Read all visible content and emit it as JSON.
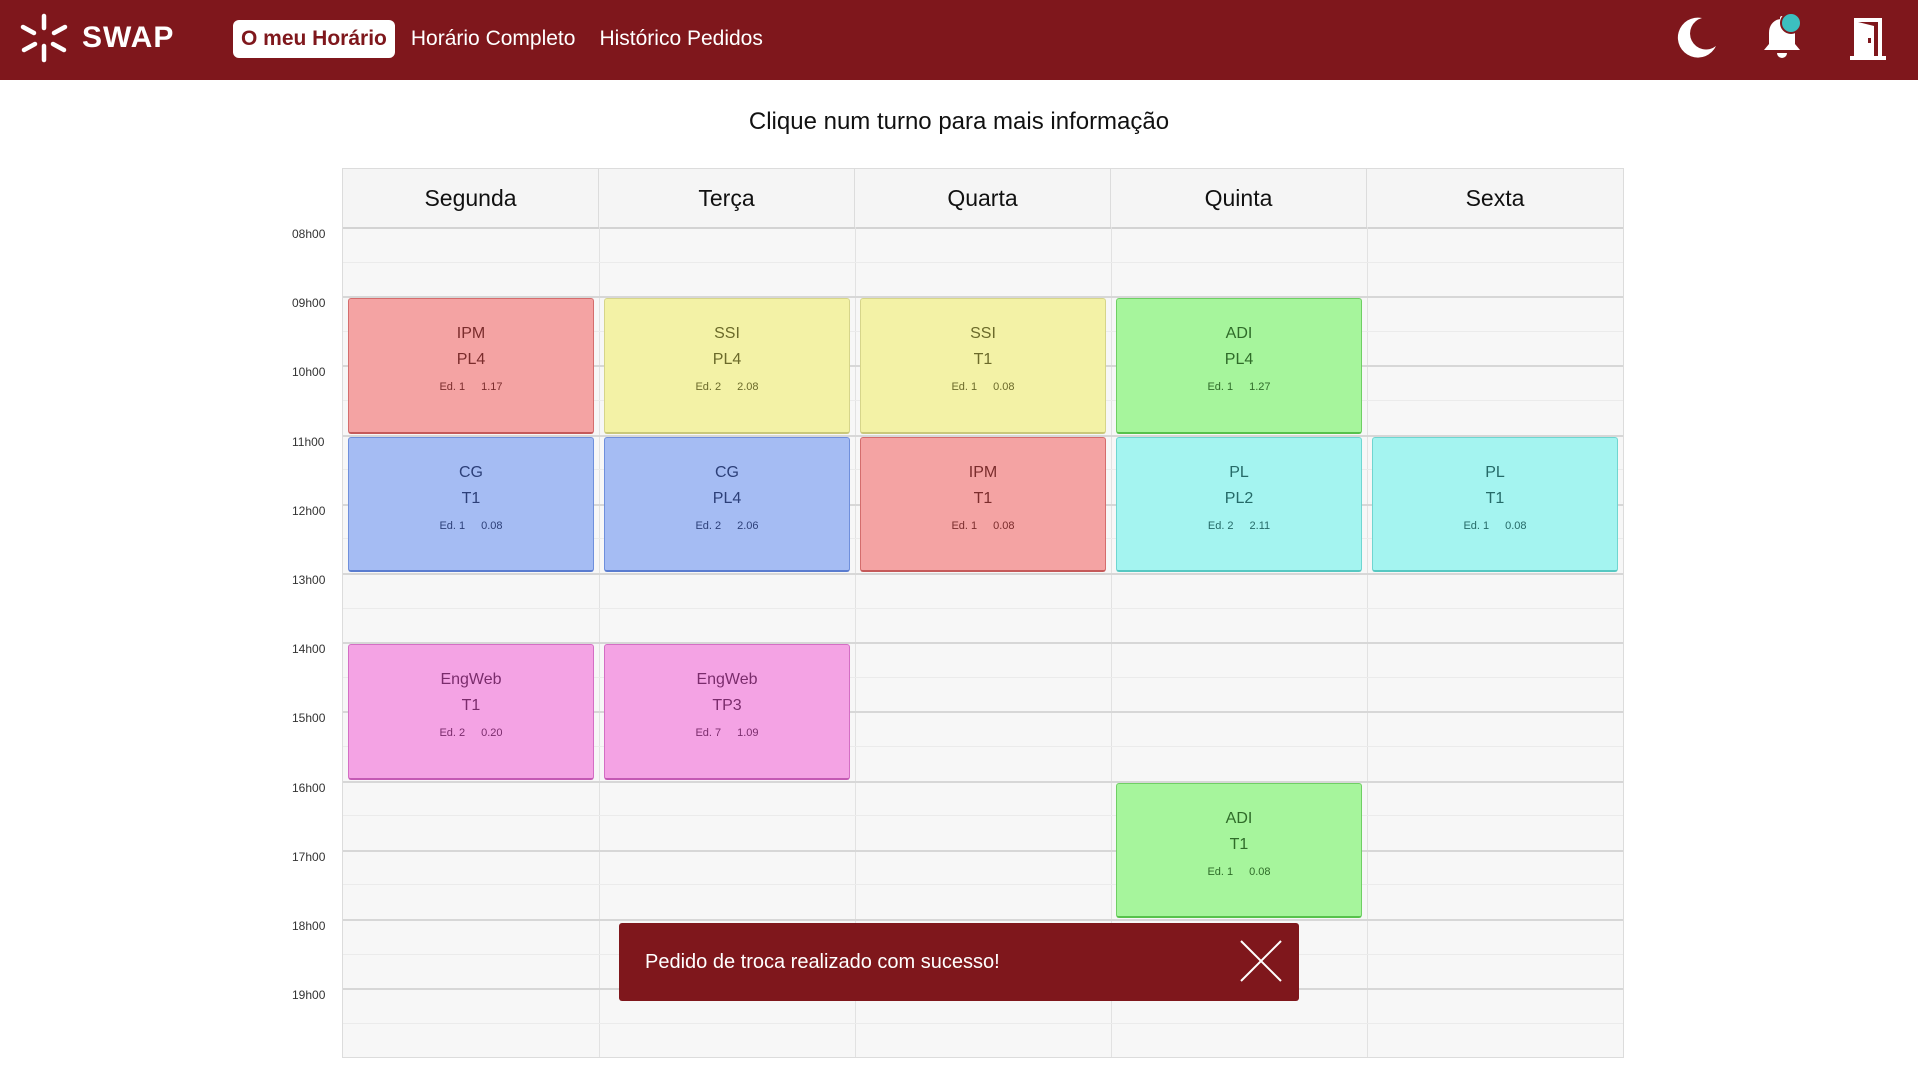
{
  "app": {
    "name": "SWAP"
  },
  "nav": {
    "items": [
      {
        "label": "O meu Horário",
        "active": true
      },
      {
        "label": "Horário Completo",
        "active": false
      },
      {
        "label": "Histórico Pedidos",
        "active": false
      }
    ]
  },
  "header_icons": [
    "moon-icon",
    "bell-icon",
    "logout-door-icon"
  ],
  "page": {
    "title": "Clique num turno para mais informação"
  },
  "days": [
    "Segunda",
    "Terça",
    "Quarta",
    "Quinta",
    "Sexta"
  ],
  "hours": [
    "08h00",
    "09h00",
    "10h00",
    "11h00",
    "12h00",
    "13h00",
    "14h00",
    "15h00",
    "16h00",
    "17h00",
    "18h00",
    "19h00"
  ],
  "shifts": [
    {
      "day": 0,
      "start": 9,
      "end": 11,
      "subject": "IPM",
      "type": "PL4",
      "building": "Ed. 1",
      "room": "1.17",
      "color": "red"
    },
    {
      "day": 1,
      "start": 9,
      "end": 11,
      "subject": "SSI",
      "type": "PL4",
      "building": "Ed. 2",
      "room": "2.08",
      "color": "yellow"
    },
    {
      "day": 2,
      "start": 9,
      "end": 11,
      "subject": "SSI",
      "type": "T1",
      "building": "Ed. 1",
      "room": "0.08",
      "color": "yellow"
    },
    {
      "day": 3,
      "start": 9,
      "end": 11,
      "subject": "ADI",
      "type": "PL4",
      "building": "Ed. 1",
      "room": "1.27",
      "color": "green"
    },
    {
      "day": 0,
      "start": 11,
      "end": 13,
      "subject": "CG",
      "type": "T1",
      "building": "Ed. 1",
      "room": "0.08",
      "color": "blue"
    },
    {
      "day": 1,
      "start": 11,
      "end": 13,
      "subject": "CG",
      "type": "PL4",
      "building": "Ed. 2",
      "room": "2.06",
      "color": "blue"
    },
    {
      "day": 2,
      "start": 11,
      "end": 13,
      "subject": "IPM",
      "type": "T1",
      "building": "Ed. 1",
      "room": "0.08",
      "color": "red"
    },
    {
      "day": 3,
      "start": 11,
      "end": 13,
      "subject": "PL",
      "type": "PL2",
      "building": "Ed. 2",
      "room": "2.11",
      "color": "cyan"
    },
    {
      "day": 4,
      "start": 11,
      "end": 13,
      "subject": "PL",
      "type": "T1",
      "building": "Ed. 1",
      "room": "0.08",
      "color": "cyan"
    },
    {
      "day": 0,
      "start": 14,
      "end": 16,
      "subject": "EngWeb",
      "type": "T1",
      "building": "Ed. 2",
      "room": "0.20",
      "color": "pink"
    },
    {
      "day": 1,
      "start": 14,
      "end": 16,
      "subject": "EngWeb",
      "type": "TP3",
      "building": "Ed. 7",
      "room": "1.09",
      "color": "pink"
    },
    {
      "day": 3,
      "start": 16,
      "end": 18,
      "subject": "ADI",
      "type": "T1",
      "building": "Ed. 1",
      "room": "0.08",
      "color": "green"
    }
  ],
  "toast": {
    "message": "Pedido de troca realizado com sucesso!"
  }
}
